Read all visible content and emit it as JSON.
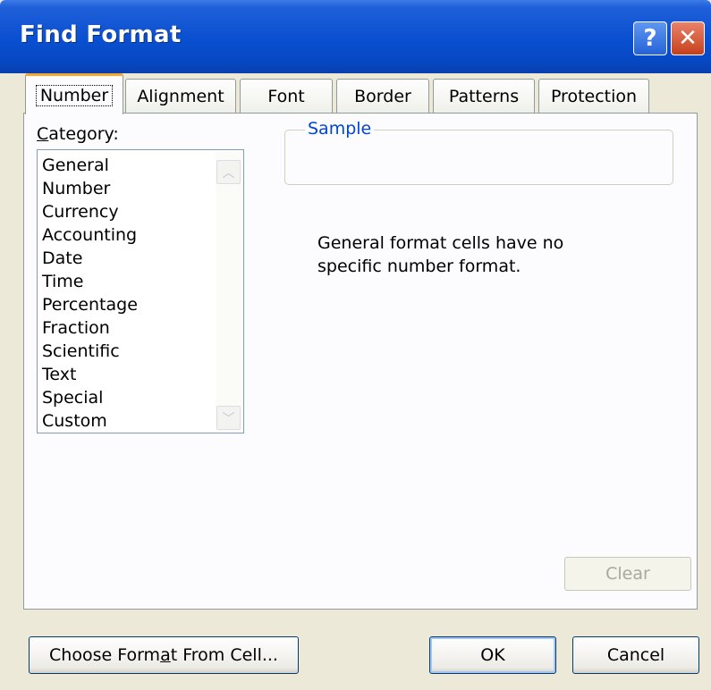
{
  "window": {
    "title": "Find Format",
    "help_glyph": "?",
    "close_glyph": "✕"
  },
  "tabs": [
    {
      "label": "Number",
      "active": true
    },
    {
      "label": "Alignment"
    },
    {
      "label": "Font"
    },
    {
      "label": "Border"
    },
    {
      "label": "Patterns"
    },
    {
      "label": "Protection"
    }
  ],
  "category": {
    "label_prefix": "C",
    "label_rest": "ategory:",
    "items": [
      "General",
      "Number",
      "Currency",
      "Accounting",
      "Date",
      "Time",
      "Percentage",
      "Fraction",
      "Scientific",
      "Text",
      "Special",
      "Custom"
    ]
  },
  "sample": {
    "label": "Sample"
  },
  "description": "General format cells have no specific number format.",
  "buttons": {
    "clear": "Clear",
    "choose_pre": "Choose Form",
    "choose_underlined": "a",
    "choose_post": "t From Cell...",
    "ok": "OK",
    "cancel": "Cancel"
  },
  "colors": {
    "title_bar": "#0a4fd1",
    "accent_tab": "#f5a733",
    "group_label": "#0046d5",
    "dialog_bg": "#ece9d8"
  }
}
